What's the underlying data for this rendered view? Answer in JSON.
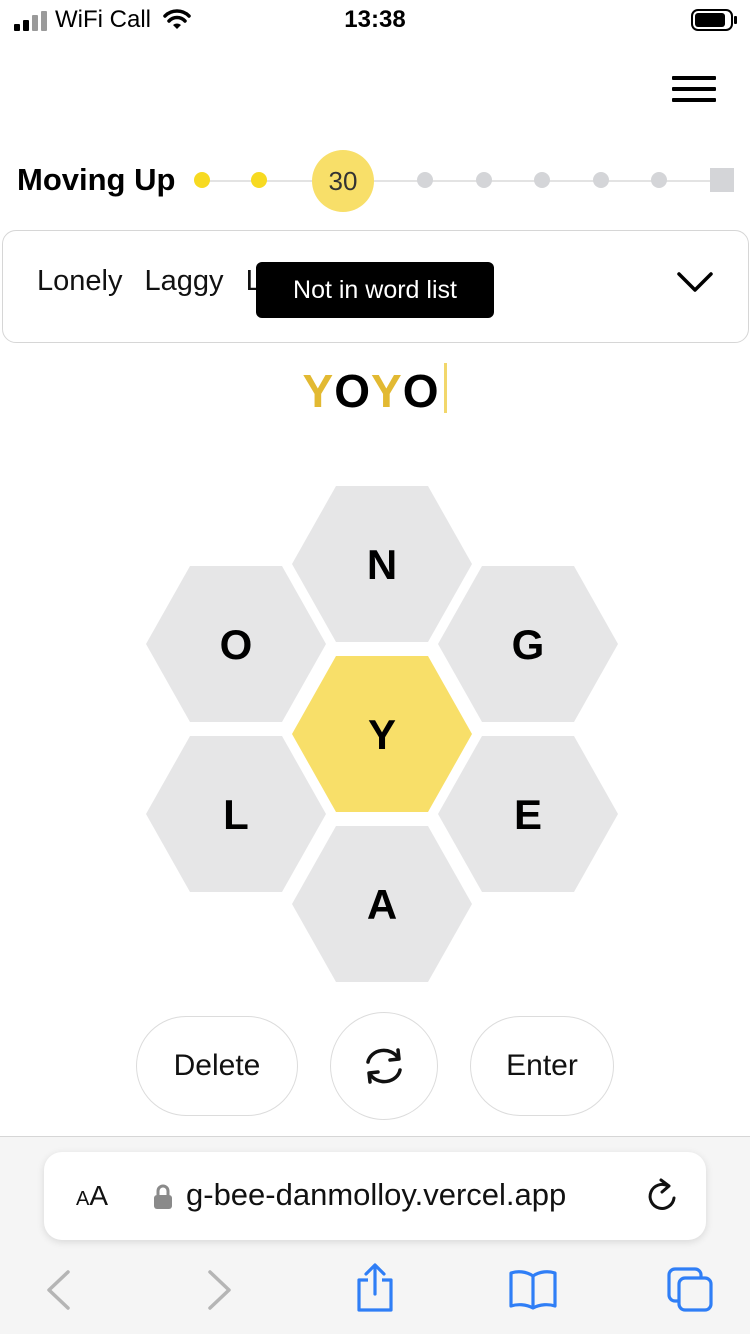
{
  "status_bar": {
    "carrier": "WiFi Call",
    "time": "13:38"
  },
  "progress": {
    "rank": "Moving Up",
    "current_score": "30",
    "rank_steps_total": 10,
    "rank_step_reached": 3
  },
  "found_words": {
    "words": [
      "Lonely",
      "Laggy",
      "L"
    ]
  },
  "toast": {
    "message": "Not in word list"
  },
  "input": {
    "letters": [
      "Y",
      "O",
      "Y",
      "O"
    ]
  },
  "hive": {
    "center_letter": "Y",
    "outer_letters": {
      "top": "N",
      "upper_left": "O",
      "upper_right": "G",
      "lower_left": "L",
      "lower_right": "E",
      "bottom": "A"
    }
  },
  "controls": {
    "delete_label": "Delete",
    "enter_label": "Enter"
  },
  "browser": {
    "text_size_label_small": "A",
    "text_size_label_large": "A",
    "url": "g-bee-danmolloy.vercel.app"
  },
  "colors": {
    "accent_yellow": "#f7da21",
    "hive_gray": "#e6e6e7",
    "center_letter_gold": "#e2b932",
    "safari_blue": "#2f7ef6"
  }
}
